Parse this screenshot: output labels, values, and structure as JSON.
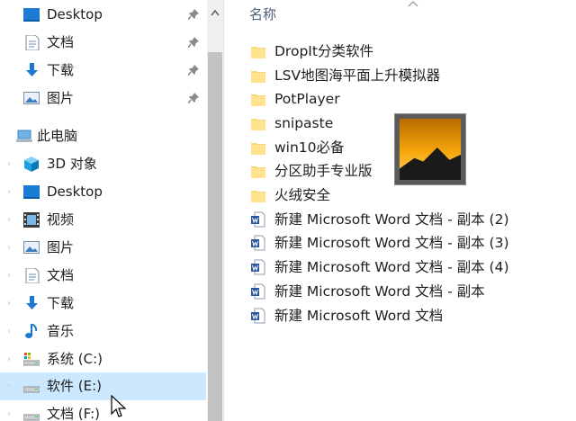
{
  "nav": {
    "items": [
      {
        "label": "Desktop",
        "icon": "desktop-icon",
        "pinned": true
      },
      {
        "label": "文档",
        "icon": "document-icon",
        "pinned": true
      },
      {
        "label": "下载",
        "icon": "download-icon",
        "pinned": true
      },
      {
        "label": "图片",
        "icon": "pictures-icon",
        "pinned": true
      },
      {
        "label": "此电脑",
        "icon": "this-pc-icon"
      },
      {
        "label": "3D 对象",
        "icon": "3d-objects-icon"
      },
      {
        "label": "Desktop",
        "icon": "desktop-icon"
      },
      {
        "label": "视频",
        "icon": "videos-icon"
      },
      {
        "label": "图片",
        "icon": "pictures-icon"
      },
      {
        "label": "文档",
        "icon": "document-icon"
      },
      {
        "label": "下载",
        "icon": "download-icon"
      },
      {
        "label": "音乐",
        "icon": "music-icon"
      },
      {
        "label": "系统 (C:)",
        "icon": "system-drive-icon"
      },
      {
        "label": "软件 (E:)",
        "icon": "drive-icon",
        "selected": true
      },
      {
        "label": "文档 (F:)",
        "icon": "drive-icon"
      }
    ]
  },
  "main": {
    "column_header": "名称",
    "files": [
      {
        "name": "DropIt分类软件",
        "type": "folder"
      },
      {
        "name": "LSV地图海平面上升模拟器",
        "type": "folder"
      },
      {
        "name": "PotPlayer",
        "type": "folder"
      },
      {
        "name": "snipaste",
        "type": "folder"
      },
      {
        "name": "win10必备",
        "type": "folder"
      },
      {
        "name": "分区助手专业版",
        "type": "folder"
      },
      {
        "name": "火绒安全",
        "type": "folder"
      },
      {
        "name": "新建 Microsoft Word 文档 - 副本 (2)",
        "type": "word"
      },
      {
        "name": "新建 Microsoft Word 文档 - 副本 (3)",
        "type": "word"
      },
      {
        "name": "新建 Microsoft Word 文档 - 副本 (4)",
        "type": "word"
      },
      {
        "name": "新建 Microsoft Word 文档 - 副本",
        "type": "word"
      },
      {
        "name": "新建 Microsoft Word 文档",
        "type": "word"
      }
    ]
  },
  "colors": {
    "selection": "#cce8ff",
    "folder": "#f8d775",
    "word_blue": "#2b579a",
    "header_text": "#4c607a"
  }
}
